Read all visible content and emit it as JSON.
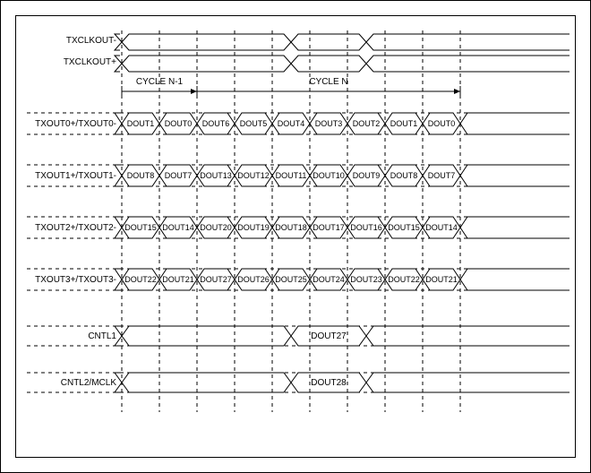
{
  "chart_data": {
    "type": "timing_diagram",
    "cycle_labels": {
      "prev": "CYCLE N-1",
      "curr": "CYCLE N"
    },
    "clock": {
      "minus": "TXCLKOUT-",
      "plus": "TXCLKOUT+"
    },
    "data_rows": [
      {
        "label": "TXOUT0+/TXOUT0-",
        "prev_tail": [
          "DOUT1",
          "DOUT0"
        ],
        "curr": [
          "DOUT6",
          "DOUT5",
          "DOUT4",
          "DOUT3",
          "DOUT2",
          "DOUT1",
          "DOUT0"
        ]
      },
      {
        "label": "TXOUT1+/TXOUT1-",
        "prev_tail": [
          "DOUT8",
          "DOUT7"
        ],
        "curr": [
          "DOUT13",
          "DOUT12",
          "DOUT11",
          "DOUT10",
          "DOUT9",
          "DOUT8",
          "DOUT7"
        ]
      },
      {
        "label": "TXOUT2+/TXOUT2-",
        "prev_tail": [
          "DOUT15",
          "DOUT14"
        ],
        "curr": [
          "DOUT20",
          "DOUT19",
          "DOUT18",
          "DOUT17",
          "DOUT16",
          "DOUT15",
          "DOUT14"
        ]
      },
      {
        "label": "TXOUT3+/TXOUT3-",
        "prev_tail": [
          "DOUT22",
          "DOUT21"
        ],
        "curr": [
          "DOUT27",
          "DOUT26",
          "DOUT25",
          "DOUT24",
          "DOUT23",
          "DOUT22",
          "DOUT21"
        ]
      }
    ],
    "control_rows": [
      {
        "label": "CNTL1",
        "value": "DOUT27"
      },
      {
        "label": "CNTL2/MCLK",
        "value": "DOUT28"
      }
    ],
    "slots": {
      "prev_tail_count": 2,
      "curr_count": 7
    }
  }
}
